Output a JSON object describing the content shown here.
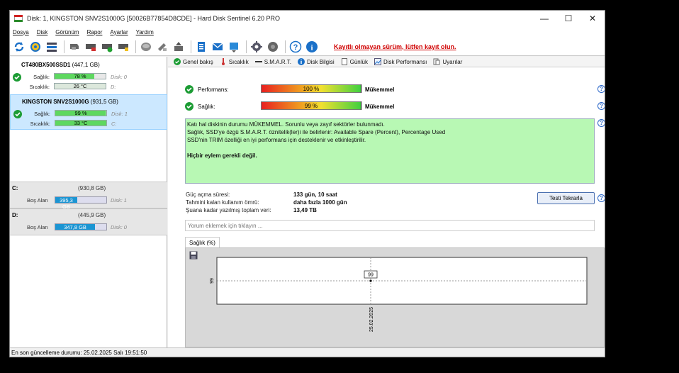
{
  "window": {
    "title": "Disk: 1, KINGSTON SNV2S1000G [50026B77854D8CDE]  -  Hard Disk Sentinel 6.20 PRO"
  },
  "menu": [
    "Dosya",
    "Disk",
    "Görünüm",
    "Rapor",
    "Ayarlar",
    "Yardım"
  ],
  "toolbar": {
    "unregistered_text": "Kayıtlı olmayan sürüm, lütfen kayıt olun."
  },
  "disks": [
    {
      "name": "CT480BX500SSD1",
      "size": "(447,1 GB)",
      "health_label": "Sağlık:",
      "health_value": "78 %",
      "health": 0.78,
      "temp_label": "Sıcaklık:",
      "temp_value": "26 °C",
      "disk_index": "Disk: 0",
      "drive": "D:"
    },
    {
      "name": "KINGSTON SNV2S1000G",
      "size": "(931,5 GB)",
      "health_label": "Sağlık:",
      "health_value": "99 %",
      "health": 0.99,
      "temp_label": "Sıcaklık:",
      "temp_value": "33 °C",
      "disk_index": "Disk: 1",
      "drive": "C:"
    }
  ],
  "volumes": [
    {
      "letter": "C:",
      "size": "(930,8 GB)",
      "free_label": "Boş Alan",
      "free_value": "395,3 GB",
      "free_fraction": 0.43,
      "disk": "Disk: 1"
    },
    {
      "letter": "D:",
      "size": "(445,9 GB)",
      "free_label": "Boş Alan",
      "free_value": "347,8 GB",
      "free_fraction": 0.78,
      "disk": "Disk: 0"
    }
  ],
  "tabs": [
    "Genel bakış",
    "Sıcaklık",
    "S.M.A.R.T.",
    "Disk Bilgisi",
    "Günlük",
    "Disk Performansı",
    "Uyarılar"
  ],
  "overview": {
    "performance_label": "Performans:",
    "performance_value": "100 %",
    "performance": 1.0,
    "performance_verdict": "Mükemmel",
    "health_label": "Sağlık:",
    "health_value": "99 %",
    "health": 0.99,
    "health_verdict": "Mükemmel",
    "status_lines": [
      "Katı hal diskinin durumu MÜKEMMEL. Sorunlu veya zayıf sektörler bulunmadı.",
      "Sağlık, SSD'ye özgü S.M.A.R.T. öznitelik(ler)i ile belirlenir:  Available Spare (Percent), Percentage Used",
      "SSD'nin TRIM özelliği en iyi performans için desteklenir ve etkinleştirilir."
    ],
    "action_text": "Hiçbir eylem gerekli değil.",
    "power_on_label": "Güç açma süresi:",
    "power_on_value": "133 gün, 10 saat",
    "lifetime_label": "Tahmini kalan kullanım ömrü:",
    "lifetime_value": "daha fazla 1000 gün",
    "written_label": "Şuana kadar yazılmış toplam veri:",
    "written_value": "13,49 TB",
    "retest_label": "Testi Tekrarla",
    "comment_placeholder": "Yorum eklemek için tıklayın ..."
  },
  "chart_data": {
    "type": "scatter",
    "tab_label": "Sağlık (%)",
    "x": [
      "25.02.2025"
    ],
    "values": [
      99
    ],
    "point_labels": [
      "99"
    ],
    "y_tick_labels": [
      "99"
    ],
    "grid": true
  },
  "statusbar": {
    "text": "En son güncelleme durumu: 25.02.2025 Salı 19:51:50"
  }
}
